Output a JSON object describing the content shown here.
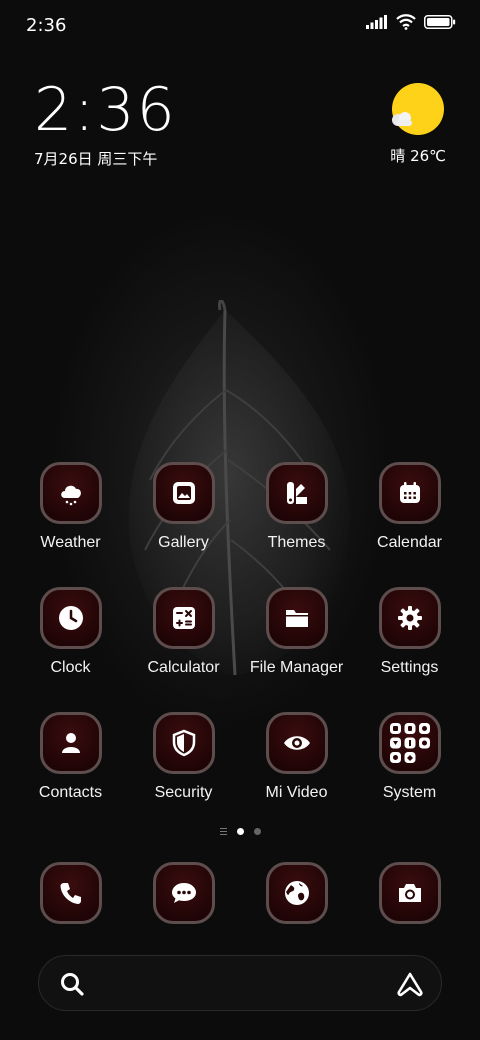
{
  "status_bar": {
    "time": "2:36"
  },
  "clock_widget": {
    "time": "2:36",
    "date": "7月26日 周三下午"
  },
  "weather_widget": {
    "text": "晴 26℃",
    "icon": "sunny-partly-cloudy-icon",
    "sun_color": "#ffd21a"
  },
  "apps": [
    {
      "label": "Weather",
      "icon": "weather-icon"
    },
    {
      "label": "Gallery",
      "icon": "gallery-icon"
    },
    {
      "label": "Themes",
      "icon": "themes-icon"
    },
    {
      "label": "Calendar",
      "icon": "calendar-icon"
    },
    {
      "label": "Clock",
      "icon": "clock-icon"
    },
    {
      "label": "Calculator",
      "icon": "calculator-icon"
    },
    {
      "label": "File Manager",
      "icon": "folder-icon"
    },
    {
      "label": "Settings",
      "icon": "gear-icon"
    },
    {
      "label": "Contacts",
      "icon": "contacts-icon"
    },
    {
      "label": "Security",
      "icon": "shield-icon"
    },
    {
      "label": "Mi Video",
      "icon": "eye-icon"
    },
    {
      "label": "System",
      "icon": "folder-grid-icon"
    }
  ],
  "page_indicator": {
    "pages": 2,
    "current": 1
  },
  "dock": [
    {
      "icon": "phone-icon"
    },
    {
      "icon": "messages-icon"
    },
    {
      "icon": "browser-icon"
    },
    {
      "icon": "camera-icon"
    }
  ],
  "search_bar": {
    "icon": "search-icon",
    "assistant_icon": "assistant-icon"
  },
  "colors": {
    "icon_border": "#5e4d4d",
    "icon_fill": "#220506",
    "background": "#0b0b0b"
  }
}
